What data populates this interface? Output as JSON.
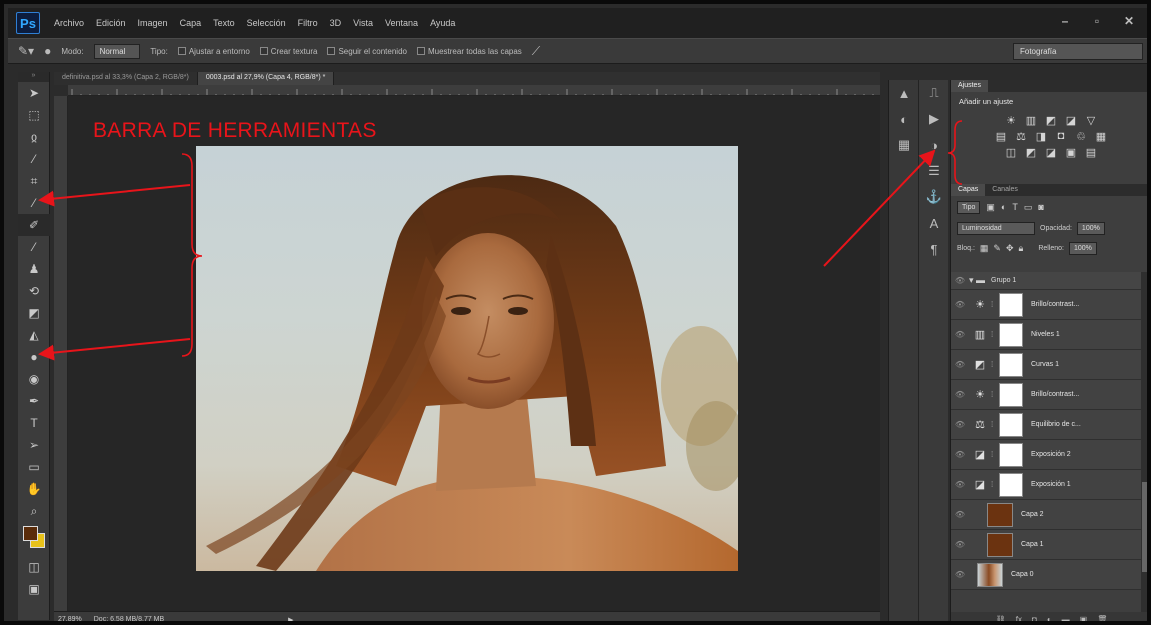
{
  "app": {
    "logo": "Ps"
  },
  "menu": [
    "Archivo",
    "Edición",
    "Imagen",
    "Capa",
    "Texto",
    "Selección",
    "Filtro",
    "3D",
    "Vista",
    "Ventana",
    "Ayuda"
  ],
  "window_controls": [
    "–",
    "▫",
    "✕"
  ],
  "options_bar": {
    "mode_label": "Modo:",
    "mode_value": "Normal",
    "type_label": "Tipo:",
    "check1": "Ajustar a entorno",
    "check2": "Crear textura",
    "check3": "Seguir el contenido",
    "check4": "Muestrear todas las capas",
    "workspace": "Fotografía"
  },
  "doc_tabs": [
    "definitiva.psd al 33,3% (Capa 2, RGB/8*)",
    "0003.psd al 27,9% (Capa 4, RGB/8*) *"
  ],
  "status": {
    "zoom": "27,89%",
    "doc": "Doc: 6,58 MB/8,77 MB",
    "arrow": "▶"
  },
  "annotation": {
    "label": "BARRA DE HERRAMIENTAS"
  },
  "colors": {
    "annotation": "#e8141a",
    "foreground": "#5a2c0a",
    "background": "#e8c21a"
  },
  "adjustments_panel": {
    "tabs": [
      "Ajustes"
    ],
    "title": "Añadir un ajuste"
  },
  "layers_panel": {
    "tabs": [
      "Capas",
      "Canales"
    ],
    "filter_label": "Tipo",
    "blend_mode": "Luminosidad",
    "opacity_label": "Opacidad:",
    "opacity_value": "100%",
    "lock_label": "Bloq.:",
    "fill_label": "Relleno:",
    "fill_value": "100%",
    "group_name": "Grupo 1",
    "layers": [
      {
        "name": "Brillo/contrast...",
        "icon": "☀",
        "type": "adjustment"
      },
      {
        "name": "Niveles 1",
        "icon": "▥",
        "type": "adjustment"
      },
      {
        "name": "Curvas 1",
        "icon": "◩",
        "type": "adjustment"
      },
      {
        "name": "Brillo/contrast...",
        "icon": "☀",
        "type": "adjustment"
      },
      {
        "name": "Equilibrio de c...",
        "icon": "⚖",
        "type": "adjustment"
      },
      {
        "name": "Exposición 2",
        "icon": "◪",
        "type": "adjustment"
      },
      {
        "name": "Exposición 1",
        "icon": "◪",
        "type": "adjustment"
      },
      {
        "name": "Capa 2",
        "type": "fill"
      },
      {
        "name": "Capa 1",
        "type": "fill"
      },
      {
        "name": "Capa 0",
        "type": "photo"
      }
    ]
  }
}
